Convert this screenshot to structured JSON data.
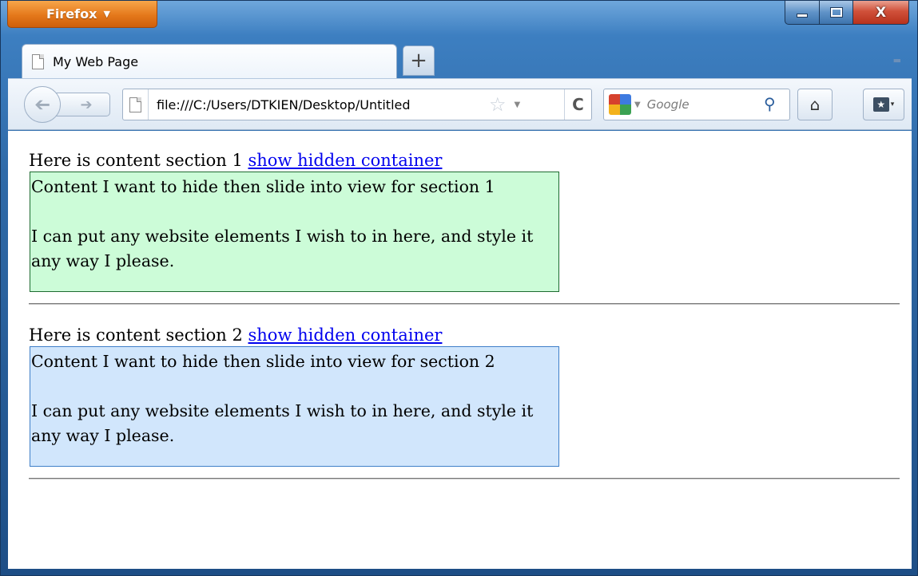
{
  "window": {
    "app_button_label": "Firefox",
    "close_label": "X"
  },
  "tabs": [
    {
      "title": "My Web Page"
    }
  ],
  "toolbar": {
    "url": "file:///C:/Users/DTKIEN/Desktop/Untitled",
    "search_placeholder": "Google"
  },
  "content": {
    "sections": [
      {
        "intro": "Here is content section 1",
        "link": "show hidden container",
        "box_line1": "Content I want to hide then slide into view for section 1",
        "box_line2": "I can put any website elements I wish to in here, and style it any way I please.",
        "box_color": "#ccfcd8",
        "box_border": "#1d6b30"
      },
      {
        "intro": "Here is content section 2",
        "link": "show hidden container",
        "box_line1": "Content I want to hide then slide into view for section 2",
        "box_line2": "I can put any website elements I wish to in here, and style it any way I please.",
        "box_color": "#d1e6fc",
        "box_border": "#3f7fc8"
      }
    ]
  },
  "colors": {
    "link": "#0000ee",
    "firefox_button": "#e4781b",
    "window_frame": "#2f6aa8"
  }
}
